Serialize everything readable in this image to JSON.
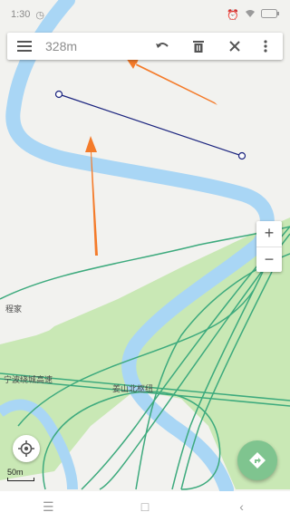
{
  "status_bar": {
    "time": "1:30",
    "battery": "",
    "left_icons": [
      "clock-icon"
    ],
    "right_icons": [
      "alarm-icon",
      "wifi-icon",
      "battery-icon"
    ]
  },
  "toolbar": {
    "distance": "328m",
    "buttons": [
      "menu",
      "undo",
      "delete",
      "close",
      "more"
    ]
  },
  "map": {
    "labels": {
      "road_name": "宁波绕城高速",
      "hub_name": "姜山北枢纽",
      "place_name": "程家"
    },
    "colors": {
      "water": "#a9d6f5",
      "green": "#c9e8b5",
      "road": "#3daa7d",
      "measure_line": "#1a237e",
      "land": "#f2f2ef"
    }
  },
  "controls": {
    "zoom_in": "+",
    "zoom_out": "−",
    "scale_label": "50m"
  },
  "nav_bar": {
    "menu": "☰",
    "home": "□",
    "back": "‹"
  }
}
